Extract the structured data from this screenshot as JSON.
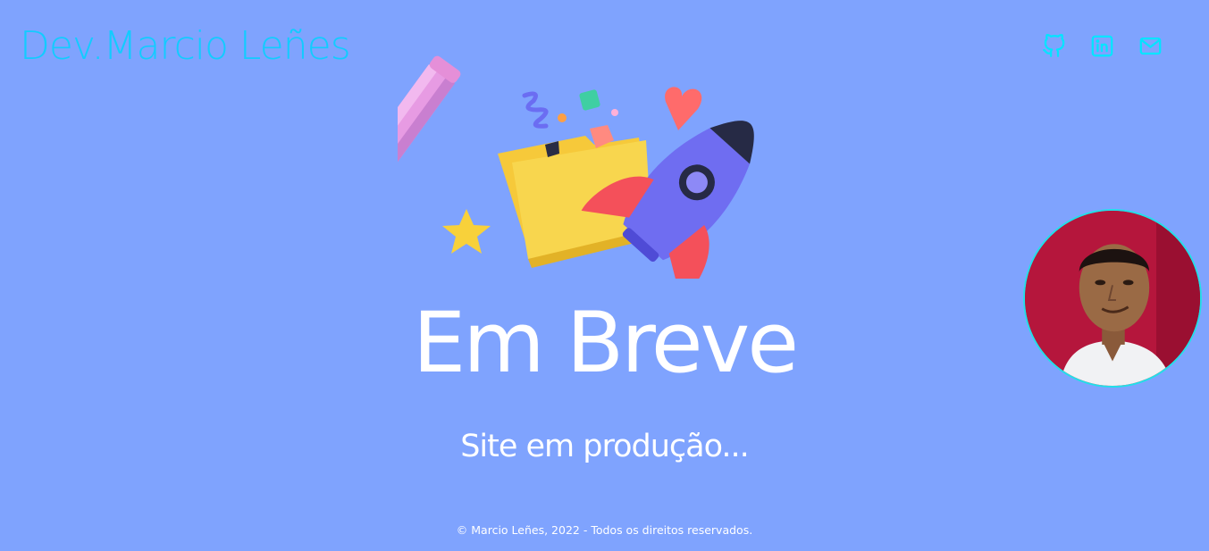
{
  "header": {
    "brand": "Dev.Marcio Leñes",
    "social": [
      {
        "name": "github-icon",
        "label": "GitHub"
      },
      {
        "name": "linkedin-icon",
        "label": "LinkedIn"
      },
      {
        "name": "mail-icon",
        "label": "Email"
      }
    ]
  },
  "hero": {
    "title": "Em Breve",
    "subtitle": "Site em produção..."
  },
  "footer": {
    "copyright": "© Marcio Leñes, 2022 - Todos os direitos reservados."
  },
  "colors": {
    "background": "#7fa3fe",
    "brand": "#11ccff",
    "icons": "#00e5ff",
    "text": "#ffffff",
    "avatar_border": "#22dfe8"
  }
}
